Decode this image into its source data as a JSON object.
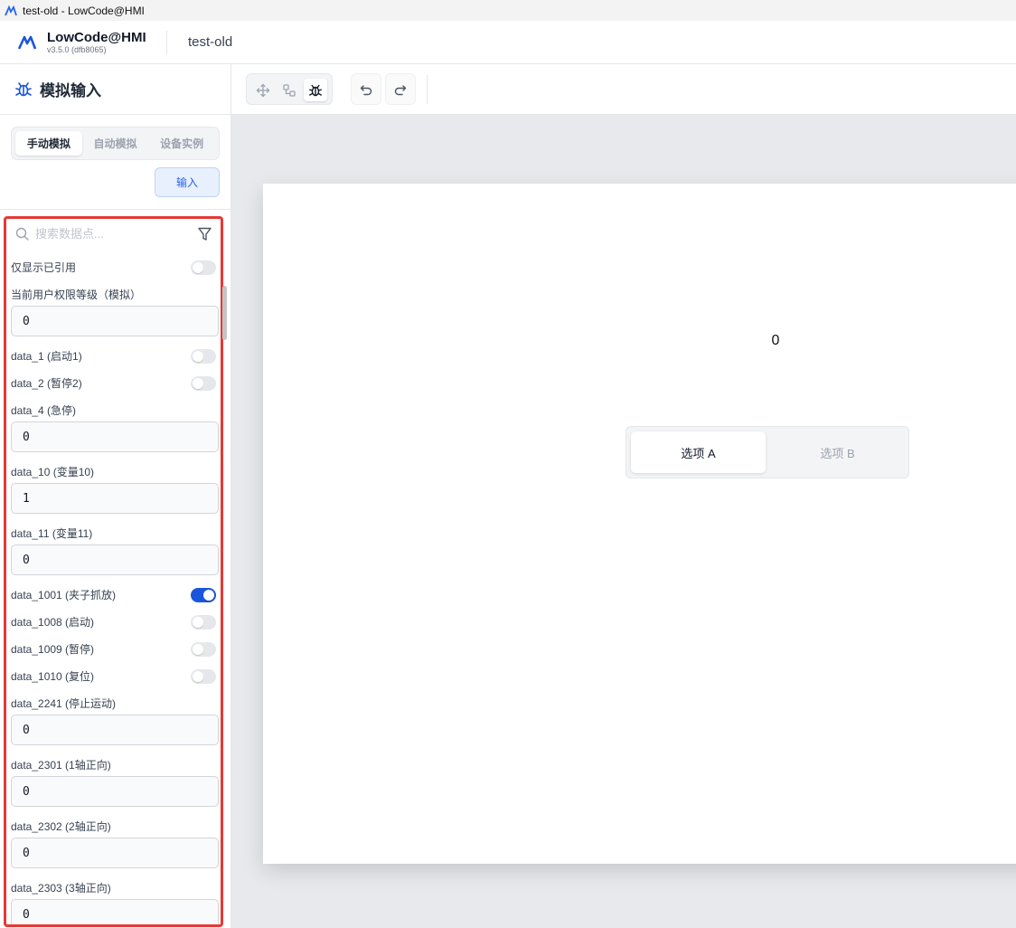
{
  "window": {
    "title": "test-old - LowCode@HMI"
  },
  "header": {
    "brand": "LowCode@HMI",
    "version": "v3.5.0 (dfb8065)",
    "project": "test-old"
  },
  "panel": {
    "title": "模拟输入",
    "tabs": [
      "手动模拟",
      "自动模拟",
      "设备实例"
    ],
    "active_tab": "手动模拟",
    "input_button": "输入",
    "search_placeholder": "搜索数据点...",
    "rows": [
      {
        "label": "仅显示已引用",
        "kind": "toggle",
        "on": false
      },
      {
        "label": "当前用户权限等级（模拟）",
        "kind": "number",
        "value": "0"
      },
      {
        "label": "data_1 (启动1)",
        "kind": "toggle",
        "on": false
      },
      {
        "label": "data_2 (暂停2)",
        "kind": "toggle",
        "on": false
      },
      {
        "label": "data_4 (急停)",
        "kind": "number",
        "value": "0"
      },
      {
        "label": "data_10 (变量10)",
        "kind": "number",
        "value": "1"
      },
      {
        "label": "data_11 (变量11)",
        "kind": "number",
        "value": "0"
      },
      {
        "label": "data_1001 (夹子抓放)",
        "kind": "toggle",
        "on": true
      },
      {
        "label": "data_1008 (启动)",
        "kind": "toggle",
        "on": false
      },
      {
        "label": "data_1009 (暂停)",
        "kind": "toggle",
        "on": false
      },
      {
        "label": "data_1010 (复位)",
        "kind": "toggle",
        "on": false
      },
      {
        "label": "data_2241 (停止运动)",
        "kind": "number",
        "value": "0"
      },
      {
        "label": "data_2301 (1轴正向)",
        "kind": "number",
        "value": "0"
      },
      {
        "label": "data_2302 (2轴正向)",
        "kind": "number",
        "value": "0"
      },
      {
        "label": "data_2303 (3轴正向)",
        "kind": "number",
        "value": "0"
      }
    ]
  },
  "toolbar": {
    "icons": [
      "move-icon",
      "connect-icon",
      "debug-icon",
      "undo-icon",
      "redo-icon"
    ],
    "active": "debug-icon"
  },
  "canvas": {
    "value_text": "0",
    "segment": {
      "options": [
        "选项 A",
        "选项 B"
      ],
      "selected": "选项 A"
    }
  },
  "colors": {
    "accent": "#1a56db",
    "highlight_border": "#e53935",
    "canvas_bg": "#e8e9ec"
  }
}
